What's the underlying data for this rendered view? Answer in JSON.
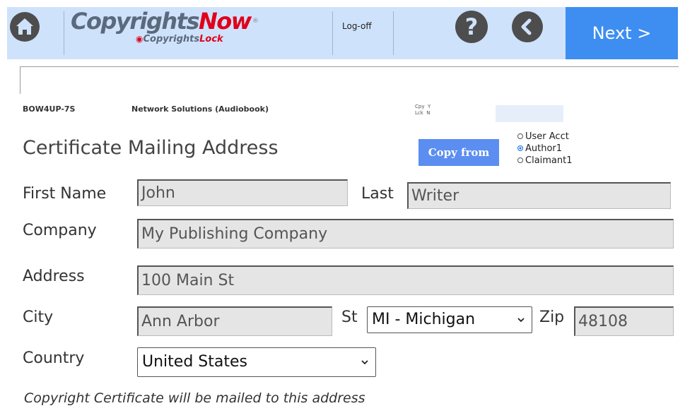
{
  "header": {
    "logo_brand_a": "Copyrights",
    "logo_brand_b": "Now",
    "logo_sub_a": "Copyrights",
    "logo_sub_b": "Lock",
    "logoff_label": "Log-off",
    "help_label": "?",
    "next_label": "Next >",
    "colors": {
      "bar": "#cfe2fb",
      "next": "#3d8ef0",
      "brand_red": "#e0001b"
    }
  },
  "info": {
    "code": "BOW4UP-7S",
    "work_title": "Network Solutions (Audiobook)",
    "cpy_label": "Cpy",
    "cpy_value": "Y",
    "lck_label": "Lck",
    "lck_value": "N"
  },
  "page": {
    "title": "Certificate Mailing Address",
    "copy_from_label": "Copy from",
    "copy_options": [
      {
        "label": "User Acct",
        "selected": false
      },
      {
        "label": "Author1",
        "selected": true
      },
      {
        "label": "Claimant1",
        "selected": false
      }
    ]
  },
  "form": {
    "first_name_label": "First Name",
    "first_name_value": "John",
    "last_label": "Last",
    "last_value": "Writer",
    "company_label": "Company",
    "company_value": "My Publishing Company",
    "address_label": "Address",
    "address_value": "100 Main St",
    "city_label": "City",
    "city_value": "Ann Arbor",
    "state_label": "St",
    "state_value": "MI - Michigan",
    "zip_label": "Zip",
    "zip_value": "48108",
    "country_label": "Country",
    "country_value": "United States"
  },
  "footer_note": "Copyright Certificate will be mailed to this address"
}
